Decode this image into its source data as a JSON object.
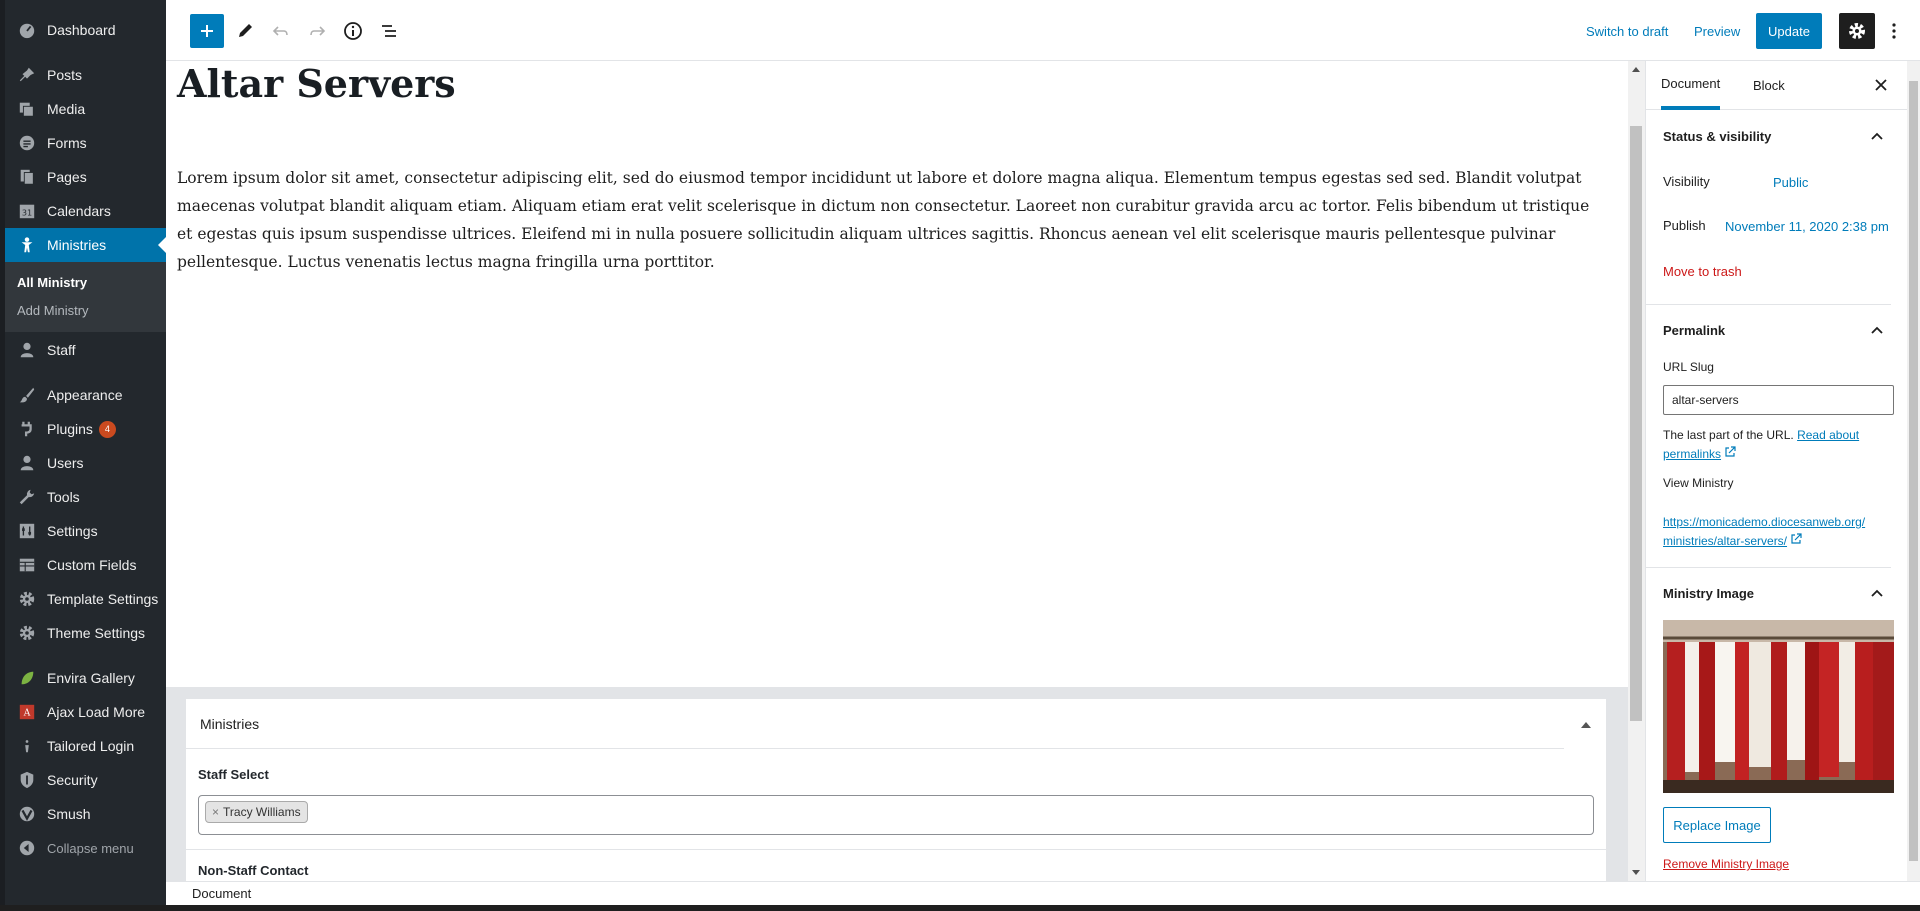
{
  "admin_menu": {
    "items": [
      {
        "label": "Dashboard",
        "icon": "dashboard-icon"
      },
      {
        "label": "Posts",
        "icon": "pin-icon"
      },
      {
        "label": "Media",
        "icon": "media-icon"
      },
      {
        "label": "Forms",
        "icon": "forms-icon"
      },
      {
        "label": "Pages",
        "icon": "pages-icon"
      },
      {
        "label": "Calendars",
        "icon": "calendar-icon"
      },
      {
        "label": "Ministries",
        "icon": "person-icon"
      },
      {
        "label": "Staff",
        "icon": "user-icon"
      },
      {
        "label": "Appearance",
        "icon": "brush-icon"
      },
      {
        "label": "Plugins",
        "icon": "plug-icon",
        "badge": "4"
      },
      {
        "label": "Users",
        "icon": "users-icon"
      },
      {
        "label": "Tools",
        "icon": "wrench-icon"
      },
      {
        "label": "Settings",
        "icon": "settings-icon"
      },
      {
        "label": "Custom Fields",
        "icon": "table-icon"
      },
      {
        "label": "Template Settings",
        "icon": "gear-icon"
      },
      {
        "label": "Theme Settings",
        "icon": "gear-icon"
      },
      {
        "label": "Envira Gallery",
        "icon": "leaf-icon"
      },
      {
        "label": "Ajax Load More",
        "icon": "alm-icon"
      },
      {
        "label": "Tailored Login",
        "icon": "login-icon"
      },
      {
        "label": "Security",
        "icon": "shield-icon"
      },
      {
        "label": "Smush",
        "icon": "smush-icon"
      }
    ],
    "submenu": [
      "All Ministry",
      "Add Ministry"
    ],
    "collapse_label": "Collapse menu"
  },
  "toolbar": {
    "switch_to_draft": "Switch to draft",
    "preview": "Preview",
    "update": "Update"
  },
  "post": {
    "title": "Altar Servers",
    "body": "Lorem ipsum dolor sit amet, consectetur adipiscing elit, sed do eiusmod tempor incididunt ut labore et dolore magna aliqua. Elementum tempus egestas sed sed. Blandit volutpat maecenas volutpat blandit aliquam etiam. Aliquam etiam erat velit scelerisque in dictum non consectetur. Laoreet non curabitur gravida arcu ac tortor. Felis bibendum ut tristique et egestas quis ipsum suspendisse ultrices. Eleifend mi in nulla posuere sollicitudin aliquam ultrices sagittis. Rhoncus aenean vel elit scelerisque mauris pellentesque pulvinar pellentesque. Luctus venenatis lectus magna fringilla urna porttitor."
  },
  "metabox": {
    "title": "Ministries",
    "staff_select_label": "Staff Select",
    "staff_selected": "Tracy Williams",
    "non_staff_label": "Non-Staff Contact"
  },
  "sidebar": {
    "tabs": [
      "Document",
      "Block"
    ],
    "status": {
      "heading": "Status & visibility",
      "visibility_label": "Visibility",
      "visibility_value": "Public",
      "publish_label": "Publish",
      "publish_value": "November 11, 2020 2:38 pm",
      "trash": "Move to trash"
    },
    "permalink": {
      "heading": "Permalink",
      "slug_label": "URL Slug",
      "slug_value": "altar-servers",
      "help_text": "The last part of the URL.",
      "help_link_1": "Read about",
      "help_link_2": "permalinks",
      "view_label": "View Ministry",
      "url_line_1": "https://monicademo.diocesanweb.org/",
      "url_line_2": "ministries/altar-servers/"
    },
    "image": {
      "heading": "Ministry Image",
      "replace": "Replace Image",
      "remove": "Remove Ministry Image"
    }
  },
  "footer": {
    "breadcrumb": "Document"
  },
  "colors": {
    "accent": "#007cba",
    "admin_bg": "#23282d",
    "active_menu": "#0073aa",
    "danger": "#cc1818"
  }
}
